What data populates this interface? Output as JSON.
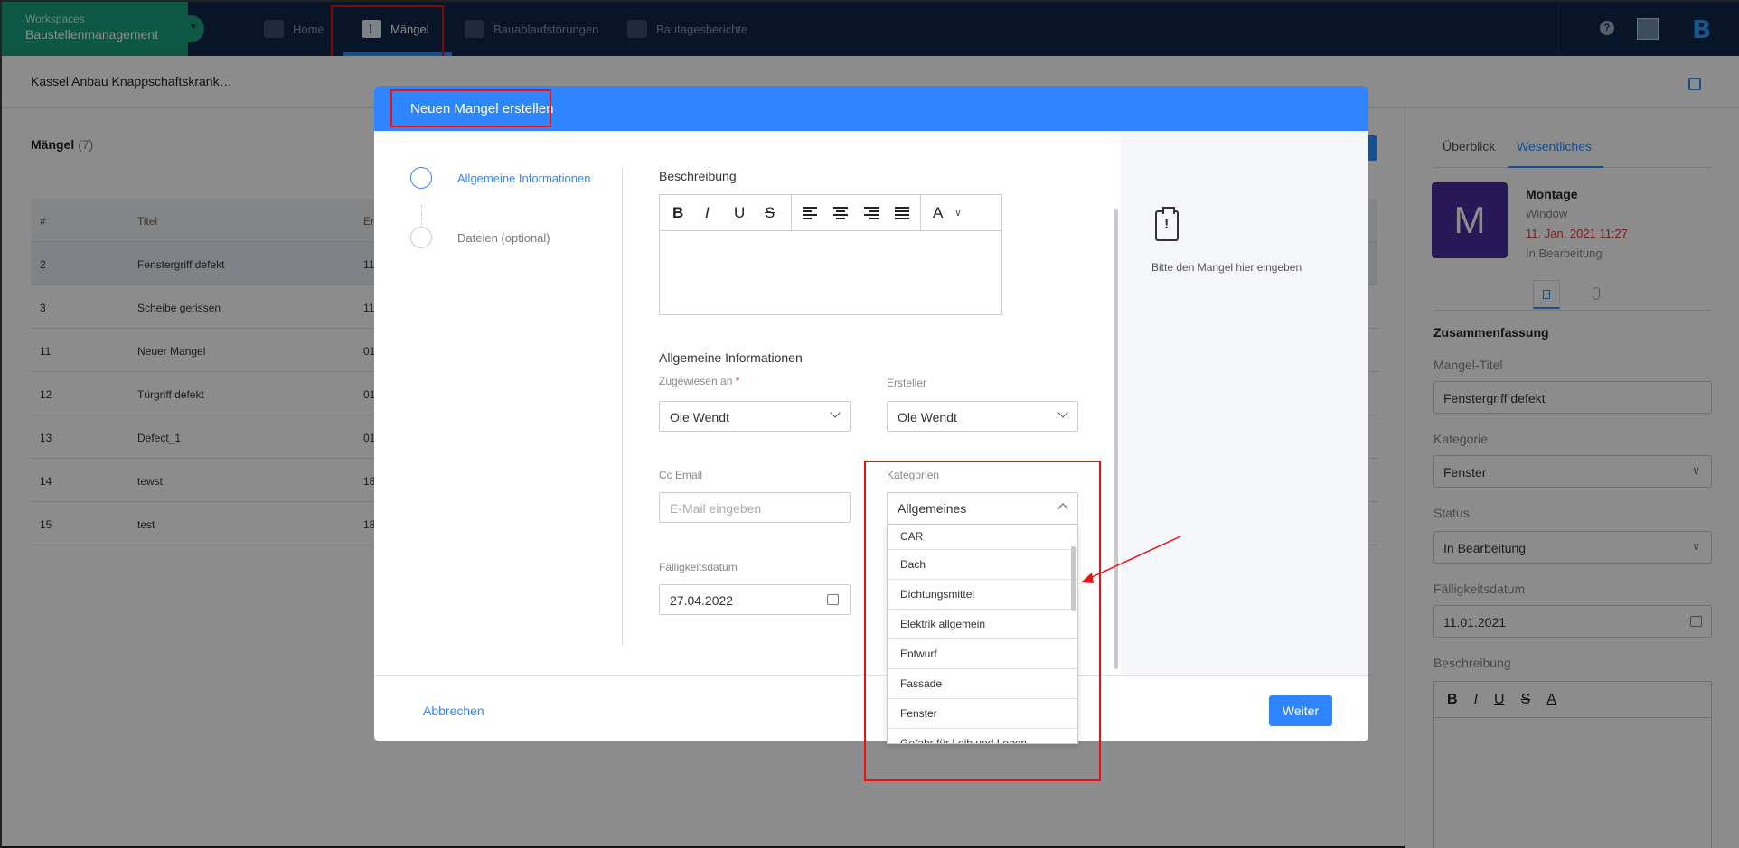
{
  "workspace": {
    "label": "Workspaces",
    "name": "Baustellenmanagement"
  },
  "nav": {
    "home": "Home",
    "maengel": "Mängel",
    "bauablauf": "Bauablaufstörungen",
    "bautages": "Bautagesberichte",
    "help": "?"
  },
  "logo": {
    "letter": "B"
  },
  "project": "Kassel Anbau Knappschaftskrank…",
  "list": {
    "title": "Mängel",
    "count": "(7)",
    "headers": [
      "#",
      "Titel",
      "Er"
    ],
    "rows": [
      {
        "id": "2",
        "title": "Fenstergriff defekt",
        "c": "11"
      },
      {
        "id": "3",
        "title": "Scheibe gerissen",
        "c": "11"
      },
      {
        "id": "11",
        "title": "Neuer Mangel",
        "c": "01"
      },
      {
        "id": "12",
        "title": "Türgriff defekt",
        "c": "01"
      },
      {
        "id": "13",
        "title": "Defect_1",
        "c": "01"
      },
      {
        "id": "14",
        "title": "tewst",
        "c": "18"
      },
      {
        "id": "15",
        "title": "test",
        "c": "18"
      }
    ]
  },
  "rightpanel": {
    "tabs": [
      "Überblick",
      "Wesentliches"
    ],
    "avatar_letter": "M",
    "info": {
      "name": "Montage",
      "sub": "Window",
      "date": "11. Jan. 2021 11:27",
      "status": "In Bearbeitung"
    },
    "summary_title": "Zusammenfassung",
    "title_label": "Mangel-Titel",
    "title_value": "Fenstergriff defekt",
    "category_label": "Kategorie",
    "category_value": "Fenster",
    "status_label": "Status",
    "status_value": "In Bearbeitung",
    "due_label": "Fälligkeitsdatum",
    "due_value": "11.01.2021",
    "desc_label": "Beschreibung"
  },
  "modal": {
    "title": "Neuen Mangel erstellen",
    "steps": [
      "Allgemeine Informationen",
      "Dateien (optional)"
    ],
    "description_label": "Beschreibung",
    "general_label": "Allgemeine Informationen",
    "assigned_label": "Zugewiesen an",
    "assigned_req": "*",
    "assigned_value": "Ole Wendt",
    "creator_label": "Ersteller",
    "creator_value": "Ole Wendt",
    "cc_label": "Cc Email",
    "cc_placeholder": "E-Mail eingeben",
    "categories_label": "Kategorien",
    "categories_value": "Allgemeines",
    "due_label": "Fälligkeitsdatum",
    "due_value": "27.04.2022",
    "category_options": [
      "CAR",
      "Dach",
      "Dichtungsmittel",
      "Elektrik allgemein",
      "Entwurf",
      "Fassade",
      "Fenster",
      "Gefahr für Leib und Leben"
    ],
    "hint": "Bitte den Mangel hier eingeben",
    "cancel": "Abbrechen",
    "next": "Weiter"
  },
  "toolbar": {
    "bold": "B",
    "italic": "I",
    "underline": "U",
    "strike": "S",
    "color": "A"
  },
  "colors": {
    "nav": "#0f2547",
    "workspace": "#16a17e",
    "primary": "#2f85ff",
    "highlight": "#ee1111",
    "avatar": "#4b2d9e"
  }
}
